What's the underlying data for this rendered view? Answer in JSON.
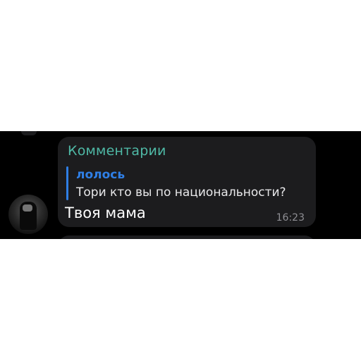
{
  "chat": {
    "message": {
      "header": "Комментарии",
      "reply": {
        "author": "лолось",
        "text": "Тори кто вы по национальности?"
      },
      "text": "Твоя мама",
      "time": "16:23"
    },
    "avatar_icon": "user-avatar-photo"
  },
  "colors": {
    "background_dark": "#000000",
    "bubble": "#1c1c1e",
    "header_accent": "#4fb9a6",
    "reply_accent": "#2f7fe6",
    "text_primary": "#ffffff",
    "text_secondary": "#8e8e93"
  }
}
